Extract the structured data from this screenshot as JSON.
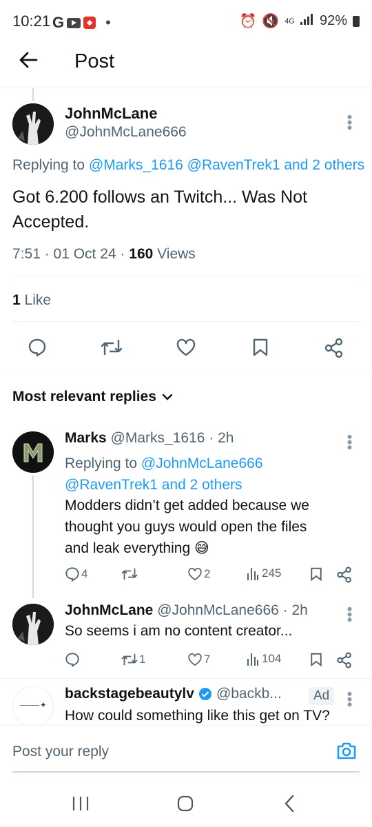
{
  "status_bar": {
    "time": "10:21",
    "g_label": "G",
    "network": "4G",
    "battery": "92%"
  },
  "header": {
    "title": "Post"
  },
  "post": {
    "author_name": "JohnMcLane",
    "author_handle": "@JohnMcLane666",
    "replying_prefix": "Replying to ",
    "replying_targets": "@Marks_1616 @RavenTrek1 and 2 others",
    "text_line1": "Got 6.200 follows an Twitch... Was Not",
    "text_line2": "Accepted.",
    "time": "7:51 · 01 Oct 24 · ",
    "views_count": "160",
    "views_label": " Views",
    "likes_count": "1",
    "likes_label": " Like"
  },
  "replies_filter": {
    "label": "Most relevant replies"
  },
  "replies": [
    {
      "name": "Marks",
      "handle": "@Marks_1616 · 2h",
      "replying_prefix": "Replying to ",
      "replying_line1": "@JohnMcLane666",
      "replying_line2": "@RavenTrek1 and 2 others",
      "text_line1": "Modders didn’t get added because we",
      "text_line2": "thought you guys would open the files",
      "text_line3": "and leak everything 😅",
      "replies": "4",
      "reposts": "",
      "likes": "2",
      "views": "245"
    },
    {
      "name": "JohnMcLane",
      "handle": "@JohnMcLane666 · 2h",
      "text_line1": "So seems i am no content creator...",
      "replies": "",
      "reposts": "1",
      "likes": "7",
      "views": "104"
    }
  ],
  "ad": {
    "name": "backstagebeautylv",
    "handle": "@backb...",
    "badge": "Ad",
    "text": "How could something like this get on TV?"
  },
  "reply_box": {
    "placeholder": "Post your reply"
  },
  "colors": {
    "accent": "#1d9bf0",
    "muted": "#536471",
    "text": "#0f1419"
  }
}
